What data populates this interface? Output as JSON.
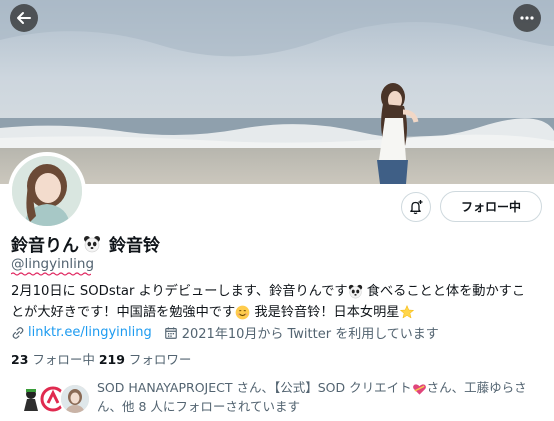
{
  "header": {
    "back_icon": "arrow-left-icon",
    "more_icon": "more-horizontal-icon"
  },
  "profile": {
    "display_name_a": "鈴音りん",
    "display_name_b": "鈴音铃",
    "handle": "@lingyinling",
    "bio_line1_a": "2月10日に SODstar よりデビューします、鈴音りんです",
    "bio_line1_b": " 食べることと体を動かすこ",
    "bio_line2_a": "とが大好きです！中国語を勉強中です",
    "bio_line2_b": " 我是铃音铃！日本女明星",
    "link_text": "linktr.ee/lingyinling",
    "joined_text": "2021年10月から Twitter を利用しています",
    "following_count": "23",
    "following_label": " フォロー中 ",
    "followers_count": "219",
    "followers_label": " フォロワー",
    "followed_by_a": "SOD HANAYAPROJECT さん、【公式】SOD クリエイト",
    "followed_by_b": "さん、工藤ゆらさ",
    "followed_by_c": "ん、他 8 人にフォローされています"
  },
  "actions": {
    "notify_icon": "bell-plus-icon",
    "follow_label": "フォロー中"
  },
  "colors": {
    "link": "#1d9bf0",
    "secondary_text": "#536471",
    "handle_underline": "#e0245e"
  }
}
